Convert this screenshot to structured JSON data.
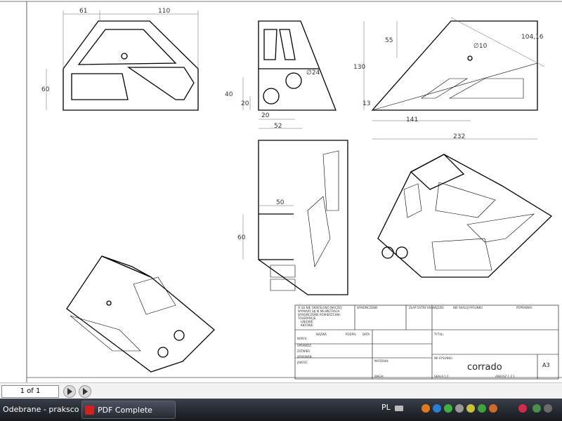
{
  "drawing": {
    "dims_top_left": {
      "d61": "61",
      "d110": "110",
      "d60": "60"
    },
    "dims_top_mid": {
      "d40": "40",
      "d20a": "20",
      "d20b": "20",
      "d52": "52",
      "dia24": "∅24"
    },
    "dims_top_right": {
      "d104": "104,16",
      "d55": "55",
      "d130": "130",
      "dia10": "∅10",
      "d13": "13",
      "d141": "141",
      "d232": "232"
    },
    "dims_side": {
      "d50": "50",
      "d60": "60"
    }
  },
  "title_block": {
    "notes": [
      "O ILE NIE OKREŚLONO INACZEJ:",
      "WYMIARY SĄ W MILIMETRACH",
      "WYKOŃCZENIE POWIERZCHNI:",
      "TOLERANCJE:",
      "LINIOWE:",
      "KĄTOWE:"
    ],
    "finish": "WYKOŃCZENIE",
    "edges": "ZŁAP OSTRE KRAWĘDZIE",
    "scale_note": "NIE SKALUJ RYSUNKU",
    "revision": "POPRAWKA",
    "cols": [
      "NAZWA",
      "PODPIS",
      "DATA"
    ],
    "rows": [
      "NARYS.",
      "SPRAWDZ.",
      "ZATWIER.",
      "WYKONAN.",
      "JAKOŚĆ"
    ],
    "title_label": "TYTUŁ:",
    "material": "MATERIAŁ:",
    "drawing_no_label": "NR RYSUNKU",
    "drawing_no": "corrado",
    "size": "A3",
    "weight": "WAGA:",
    "scale": "SKALA:1:2",
    "sheet": "ARKUSZ 1 Z 1"
  },
  "viewer": {
    "page_field": "1 of 1"
  },
  "taskbar": {
    "task1": "Odebrane - praksco...",
    "task2": "PDF Complete",
    "lang": "PL",
    "colors": {
      "taskbar_top": "#3a3f48",
      "taskbar_bottom": "#15181d"
    }
  }
}
